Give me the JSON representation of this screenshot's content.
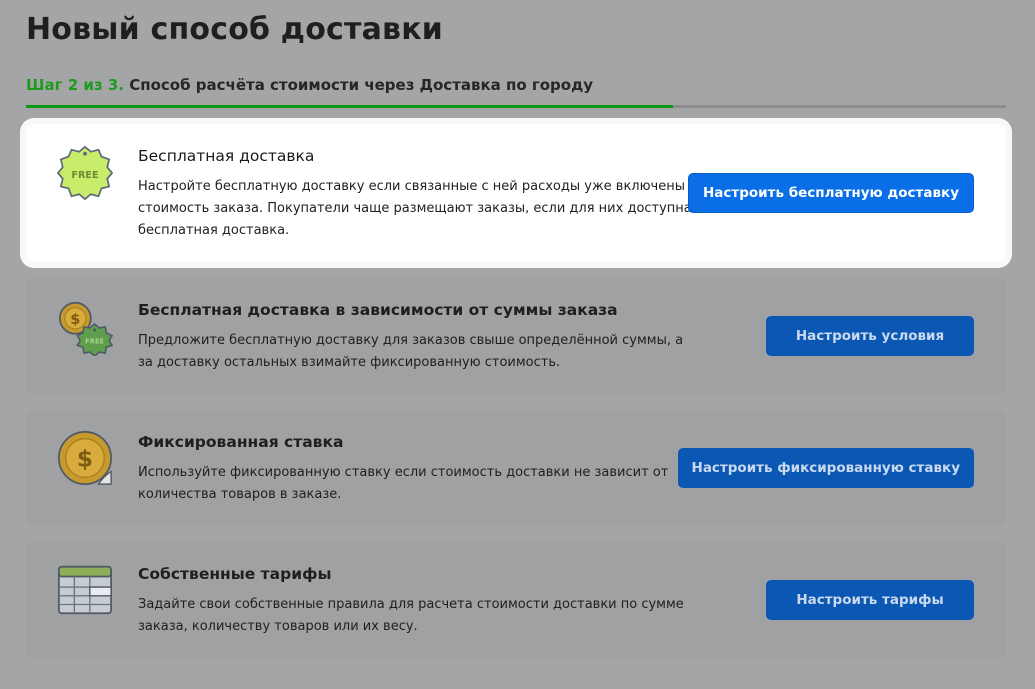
{
  "page": {
    "title": "Новый способ доставки"
  },
  "step": {
    "label": "Шаг 2 из 3.",
    "text": "Способ расчёта стоимости через Доставка по городу",
    "progress": 0.66
  },
  "colors": {
    "primary": "#0a6fe6",
    "step_green": "#1e9a1e"
  },
  "options": [
    {
      "icon": "free-badge-icon",
      "icon_text": "FREE",
      "title": "Бесплатная доставка",
      "description": "Настройте бесплатную доставку если связанные с ней расходы уже включены в стоимость заказа. Покупатели чаще размещают заказы, если для них доступна бесплатная доставка.",
      "button": "Настроить бесплатную доставку",
      "active": true
    },
    {
      "icon": "coin-free-badge-icon",
      "icon_text": "FREE",
      "title": "Бесплатная доставка в зависимости от суммы заказа",
      "description": "Предложите бесплатную доставку для заказов свыше определённой суммы, а за доставку остальных взимайте фиксированную стоимость.",
      "button": "Настроить условия",
      "active": false
    },
    {
      "icon": "dollar-coin-sticker-icon",
      "title": "Фиксированная ставка",
      "description": "Используйте фиксированную ставку если стоимость доставки не зависит от количества товаров в заказе.",
      "button": "Настроить фиксированную ставку",
      "active": false
    },
    {
      "icon": "table-grid-icon",
      "title": "Собственные тарифы",
      "description": "Задайте свои собственные правила для расчета стоимости доставки по сумме заказа, количеству товаров или их весу.",
      "button": "Настроить тарифы",
      "active": false
    }
  ]
}
